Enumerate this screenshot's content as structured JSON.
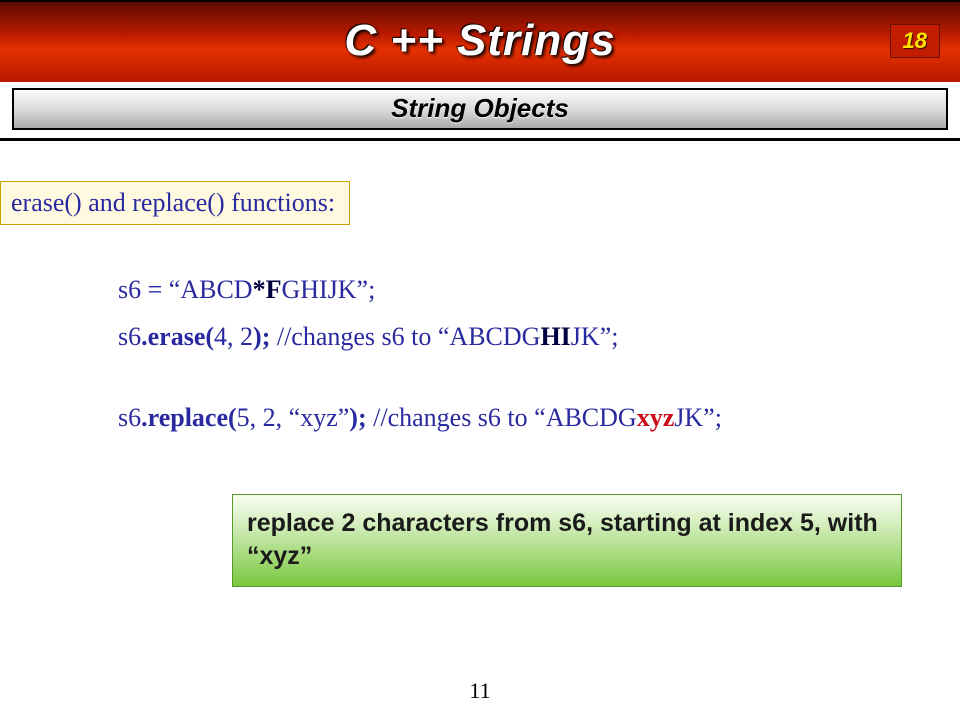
{
  "banner": {
    "title": "C ++ Strings",
    "slide_number": "18"
  },
  "subtitle": "String Objects",
  "section_label": "erase() and replace() functions:",
  "code": {
    "line1_a": "s6 = “ABCD",
    "line1_b": "*F",
    "line1_c": "GHIJK”;",
    "line2_a": "s6",
    "line2_b": ".erase(",
    "line2_c": "4, 2",
    "line2_d": "); ",
    "line2_e": "//changes s6 to “ABCDG",
    "line2_f": "HI",
    "line2_g": "JK”;",
    "line3_a": "s6",
    "line3_b": ".replace(",
    "line3_c": "5, 2, “xyz”",
    "line3_d": "); ",
    "line3_e": "//changes s6 to “ABCDG",
    "line3_f": "xyz",
    "line3_g": "JK”;"
  },
  "callout": "replace 2 characters from s6, starting at index 5, with “xyz”",
  "page_number": "11"
}
